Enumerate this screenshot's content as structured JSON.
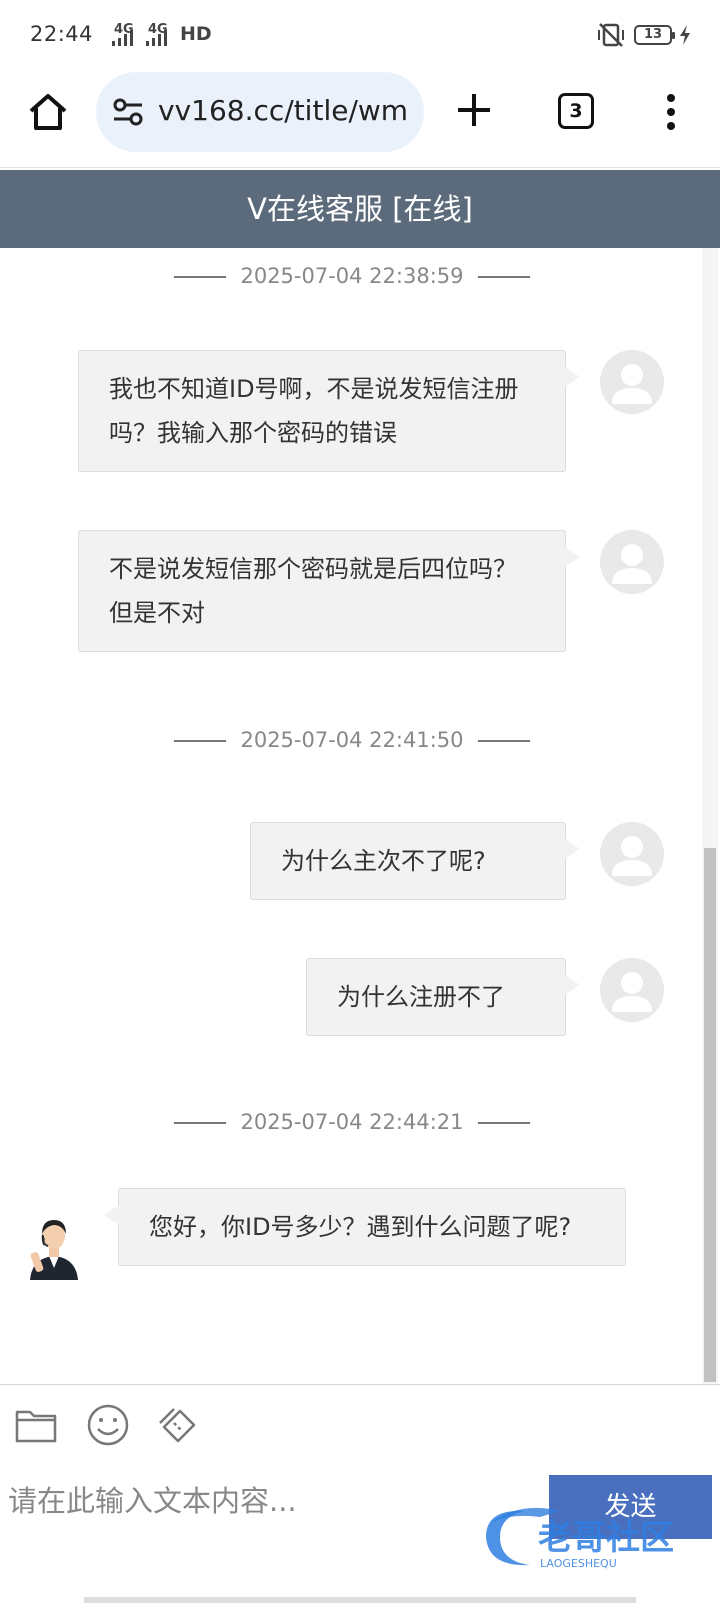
{
  "status_bar": {
    "time": "22:44",
    "signal_1": "4G",
    "signal_2": "4G",
    "hd": "HD",
    "battery": "13"
  },
  "browser": {
    "url": "vv168.cc/title/wm",
    "tab_count": "3"
  },
  "chat": {
    "title": "V在线客服 [在线]",
    "messages": [
      {
        "type": "time",
        "text": "2025-07-04 22:38:59"
      },
      {
        "type": "user",
        "text": "我也不知道ID号啊，不是说发短信注册吗？我输入那个密码的错误"
      },
      {
        "type": "user",
        "text": "不是说发短信那个密码就是后四位吗？但是不对"
      },
      {
        "type": "time",
        "text": "2025-07-04 22:41:50"
      },
      {
        "type": "user",
        "text": "为什么主次不了呢?"
      },
      {
        "type": "user",
        "text": "为什么注册不了"
      },
      {
        "type": "time",
        "text": "2025-07-04 22:44:21"
      },
      {
        "type": "agent",
        "text": "您好，你ID号多少？遇到什么问题了呢?"
      }
    ]
  },
  "composer": {
    "placeholder": "请在此输入文本内容...",
    "send_label": "发送"
  },
  "watermark": {
    "text": "老哥社区",
    "sub": "LAOGESHEQU"
  },
  "colors": {
    "header_bg": "#5c6b7b",
    "send_bg": "#4a6fbf",
    "bubble_bg": "#f2f2f2"
  }
}
